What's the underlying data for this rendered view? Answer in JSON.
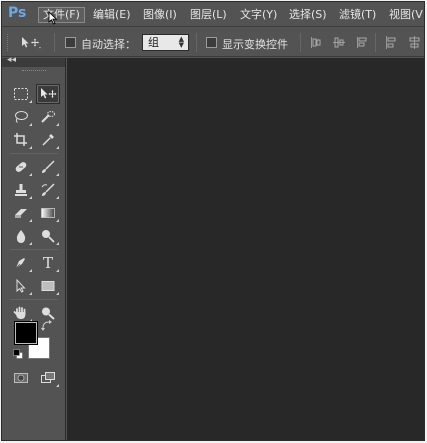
{
  "app": {
    "logo": "Ps"
  },
  "menu": {
    "items": [
      {
        "label": "文件(F)",
        "active": true
      },
      {
        "label": "编辑(E)",
        "active": false
      },
      {
        "label": "图像(I)",
        "active": false
      },
      {
        "label": "图层(L)",
        "active": false
      },
      {
        "label": "文字(Y)",
        "active": false
      },
      {
        "label": "选择(S)",
        "active": false
      },
      {
        "label": "滤镜(T)",
        "active": false
      },
      {
        "label": "视图(V",
        "active": false
      }
    ]
  },
  "options": {
    "tool_icon": "move-tool-icon",
    "auto_select_label": "自动选择：",
    "auto_select_checked": false,
    "auto_select_value": "组",
    "transform_label": "显示变换控件",
    "transform_checked": false
  },
  "toolbox": {
    "collapse_glyph": "◂◂",
    "tools": [
      {
        "name": "rectangular-marquee-icon"
      },
      {
        "name": "move-icon",
        "selected": true
      },
      {
        "name": "lasso-icon"
      },
      {
        "name": "quick-selection-icon"
      },
      {
        "name": "crop-icon"
      },
      {
        "name": "eyedropper-icon"
      },
      {
        "name": "spot-healing-icon"
      },
      {
        "name": "brush-icon"
      },
      {
        "name": "clone-stamp-icon"
      },
      {
        "name": "history-brush-icon"
      },
      {
        "name": "eraser-icon"
      },
      {
        "name": "gradient-icon"
      },
      {
        "name": "blur-icon"
      },
      {
        "name": "dodge-icon"
      },
      {
        "name": "pen-icon"
      },
      {
        "name": "type-icon"
      },
      {
        "name": "path-selection-icon"
      },
      {
        "name": "rectangle-shape-icon"
      },
      {
        "name": "hand-icon"
      },
      {
        "name": "zoom-icon"
      },
      {
        "name": "quick-mask-icon"
      },
      {
        "name": "screen-mode-icon"
      }
    ],
    "type_glyph": "T",
    "foreground_color": "#000000",
    "background_color": "#ffffff"
  },
  "colors": {
    "chrome": "#535353",
    "canvas": "#282828",
    "logo": "#6aa8e6"
  }
}
